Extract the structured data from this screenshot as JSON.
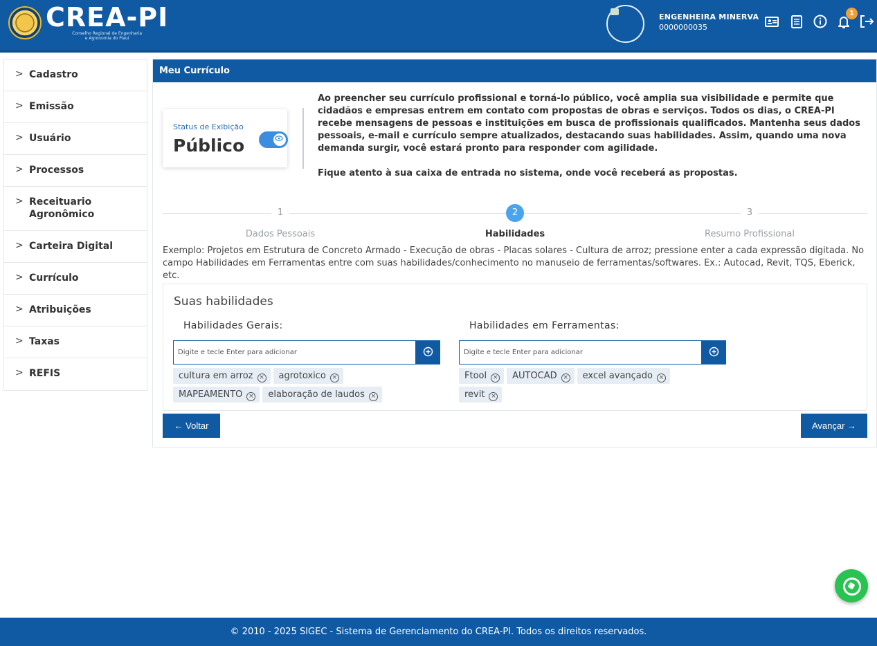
{
  "header": {
    "logo_title": "CREA-PI",
    "logo_subtitle_1": "Conselho Regional de Engenharia",
    "logo_subtitle_2": "e Agronomia do Piauí",
    "user_name": "ENGENHEIRA MINERVA",
    "user_id": "0000000035",
    "notification_count": "1",
    "icons": [
      "id-card-icon",
      "document-icon",
      "info-icon",
      "bell-icon",
      "logout-icon"
    ]
  },
  "sidebar": {
    "items": [
      {
        "label": "Cadastro"
      },
      {
        "label": "Emissão"
      },
      {
        "label": "Usuário"
      },
      {
        "label": "Processos"
      },
      {
        "label": "Receituario Agronômico"
      },
      {
        "label": "Carteira Digital"
      },
      {
        "label": "Currículo"
      },
      {
        "label": "Atribuições"
      },
      {
        "label": "Taxas"
      },
      {
        "label": "REFIS"
      }
    ]
  },
  "main": {
    "title": "Meu Currículo",
    "status_label": "Status de Exibição",
    "status_value": "Público",
    "intro_p1": "Ao preencher seu currículo profissional e torná-lo público, você amplia sua visibilidade e permite que cidadãos e empresas entrem em contato com propostas de obras e serviços. Todos os dias, o CREA-PI recebe mensagens de pessoas e instituições em busca de profissionais qualificados. Mantenha seus dados pessoais, e-mail e currículo sempre atualizados, destacando suas habilidades. Assim, quando uma nova demanda surgir, você estará pronto para responder com agilidade.",
    "intro_p2": "Fique atento à sua caixa de entrada no sistema, onde você receberá as propostas.",
    "steps": [
      {
        "number": "1",
        "label": "Dados Pessoais"
      },
      {
        "number": "2",
        "label": "Habilidades"
      },
      {
        "number": "3",
        "label": "Resumo Profissional"
      }
    ],
    "hint": "Exemplo: Projetos em Estrutura de Concreto Armado - Execução de obras - Placas solares - Cultura de arroz; pressione enter a cada expressão digitada. No campo Habilidades em Ferramentas entre com suas habilidades/conhecimento no manuseio de ferramentas/softwares. Ex.: Autocad, Revit, TQS, Eberick, etc.",
    "skills_title": "Suas habilidades",
    "general": {
      "title": "Habilidades Gerais:",
      "placeholder": "Digite e tecle Enter para adicionar",
      "chips": [
        "cultura em arroz",
        "agrotoxico",
        "MAPEAMENTO",
        "elaboração de laudos"
      ]
    },
    "tools": {
      "title": "Habilidades em Ferramentas:",
      "placeholder": "Digite e tecle Enter para adicionar",
      "chips": [
        "Ftool",
        "AUTOCAD",
        "excel avançado",
        "revit"
      ]
    },
    "back_label": "← Voltar",
    "next_label": "Avançar →"
  },
  "footer": {
    "text": "© 2010 - 2025 SIGEC - Sistema de Gerenciamento do CREA-PI. Todos os direitos reservados."
  },
  "colors": {
    "brand": "#0f5aa3",
    "step_active": "#4aa3ef",
    "whatsapp": "#29c352",
    "badge": "#f0a035"
  }
}
